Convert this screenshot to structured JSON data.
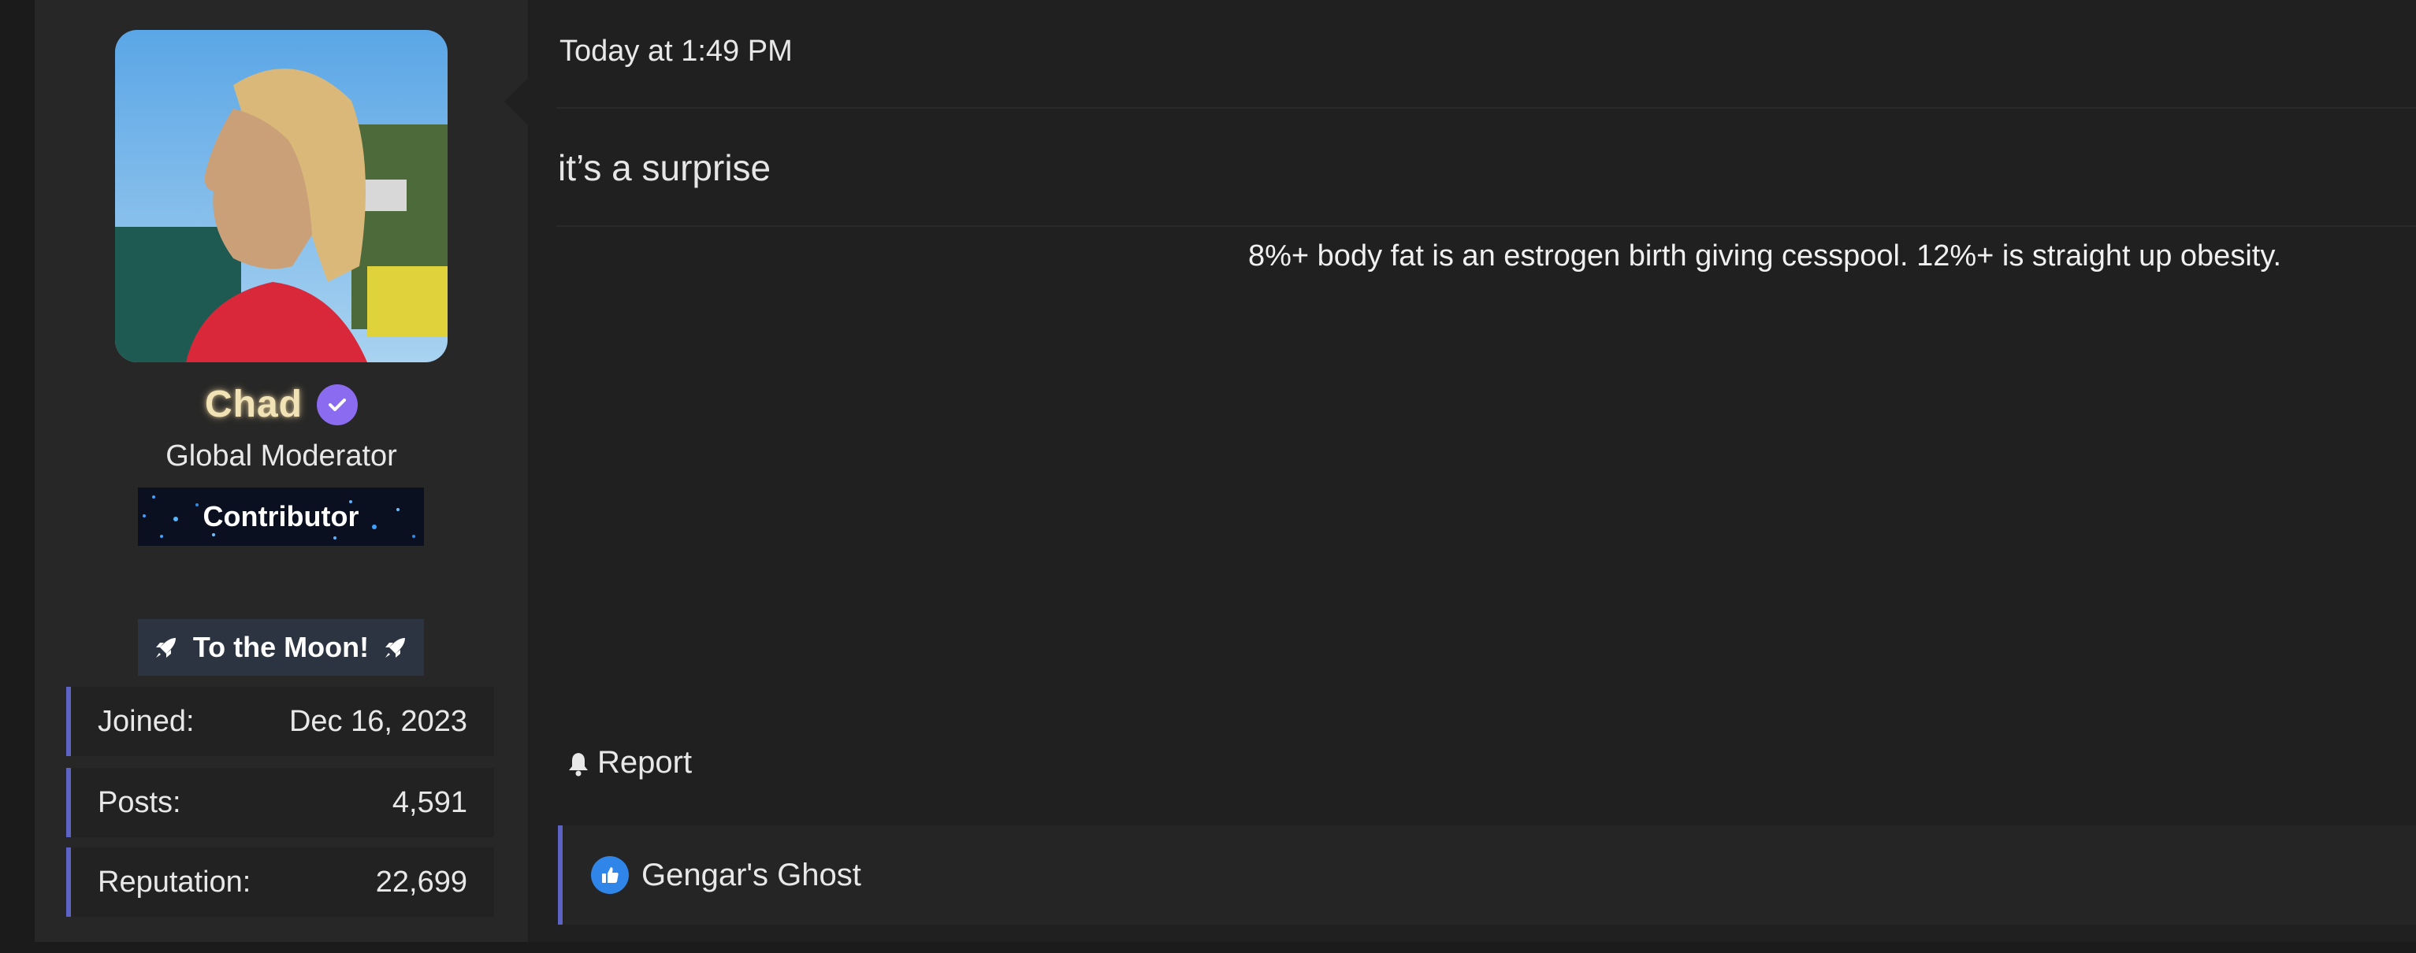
{
  "post": {
    "timestamp": "Today at 1:49 PM",
    "body": "it’s a surprise",
    "signature": "8%+ body fat is an estrogen birth giving cesspool. 12%+ is straight up obesity.",
    "report_label": "Report"
  },
  "user": {
    "name": "Chad",
    "title": "Global Moderator",
    "banner_primary": "Contributor",
    "banner_secondary": "To the Moon!",
    "stats": [
      {
        "label": "Joined:",
        "value": "Dec 16, 2023"
      },
      {
        "label": "Posts:",
        "value": "4,591"
      },
      {
        "label": "Reputation:",
        "value": "22,699"
      }
    ]
  },
  "reactions": {
    "icon": "thumbs-up-icon",
    "users": "Gengar's Ghost"
  },
  "colors": {
    "background": "#202020",
    "sidebar": "#272727",
    "accent": "#5d63c4",
    "username": "#f2e3b6",
    "verified": "#8b6cf0",
    "like": "#2f86e8"
  }
}
